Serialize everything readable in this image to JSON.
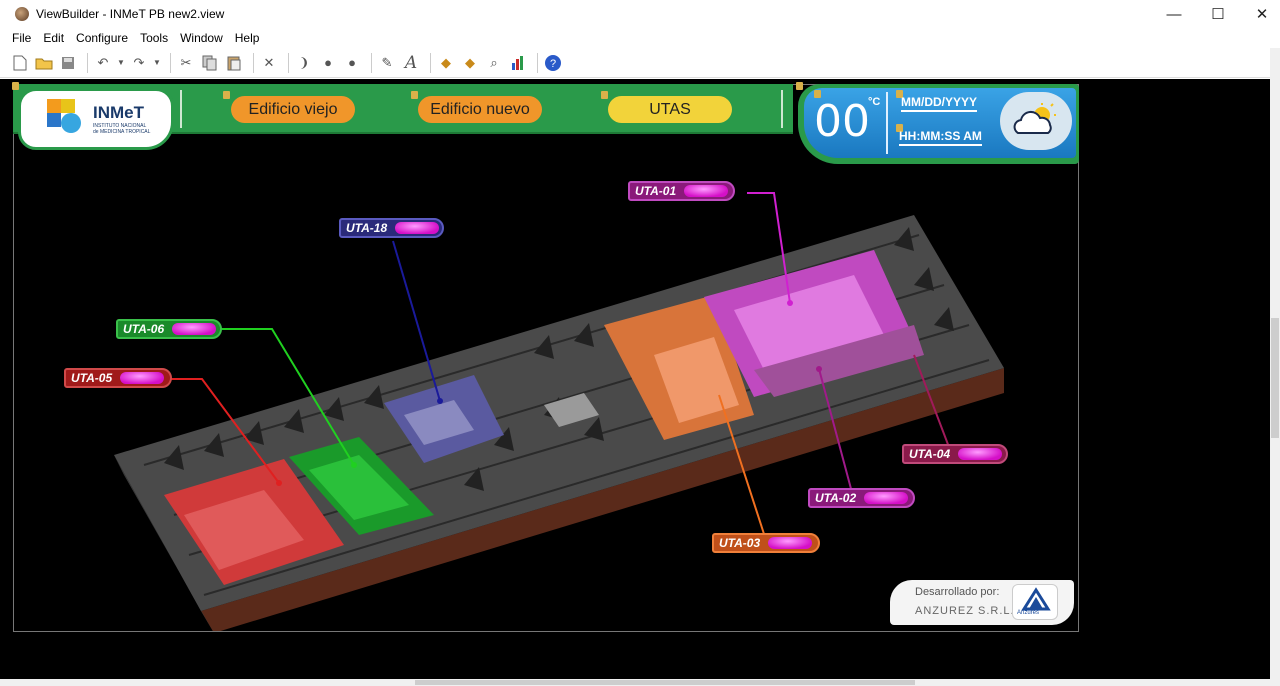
{
  "window": {
    "title": "ViewBuilder - INMeT PB new2.view",
    "minimize": "—",
    "maximize": "☐",
    "close": "✕"
  },
  "menu": [
    "File",
    "Edit",
    "Configure",
    "Tools",
    "Window",
    "Help"
  ],
  "toolbar_icons": [
    "new-file-icon",
    "open-folder-icon",
    "save-icon",
    "undo-icon",
    "redo-icon",
    "cut-icon",
    "copy-icon",
    "paste-icon",
    "delete-icon",
    "align-icon",
    "globe-icon",
    "sphere-icon",
    "pen-icon",
    "font-icon",
    "tag-icon",
    "tag2-icon",
    "search-icon",
    "chart-icon",
    "help-icon"
  ],
  "header": {
    "logo_main": "INMeT",
    "logo_sub1": "INSTITUTO NACIONAL",
    "logo_sub2": "de MEDICINA TROPICAL",
    "buttons": [
      {
        "label": "Edificio viejo",
        "color": "#f0962a"
      },
      {
        "label": "Edificio nuevo",
        "color": "#f0962a"
      },
      {
        "label": "UTAS",
        "color": "#f2d33a"
      }
    ]
  },
  "weather": {
    "temperature": "00",
    "unit": "°C",
    "date": "MM/DD/YYYY",
    "time": "HH:MM:SS AM",
    "icon": "cloud-sun-icon"
  },
  "uta_labels": [
    {
      "label": "UTA-01",
      "color": "#8a1a7a"
    },
    {
      "label": "UTA-18",
      "color": "#2a2a7a"
    },
    {
      "label": "UTA-06",
      "color": "#1a8a2a"
    },
    {
      "label": "UTA-05",
      "color": "#a01a1a"
    },
    {
      "label": "UTA-04",
      "color": "#8a1a4a"
    },
    {
      "label": "UTA-02",
      "color": "#8a1a7a"
    },
    {
      "label": "UTA-03",
      "color": "#c0501a"
    }
  ],
  "credits": {
    "line1": "Desarrollado por:",
    "line2": "ANZUREZ S.R.L.",
    "badge": "Anzures"
  }
}
